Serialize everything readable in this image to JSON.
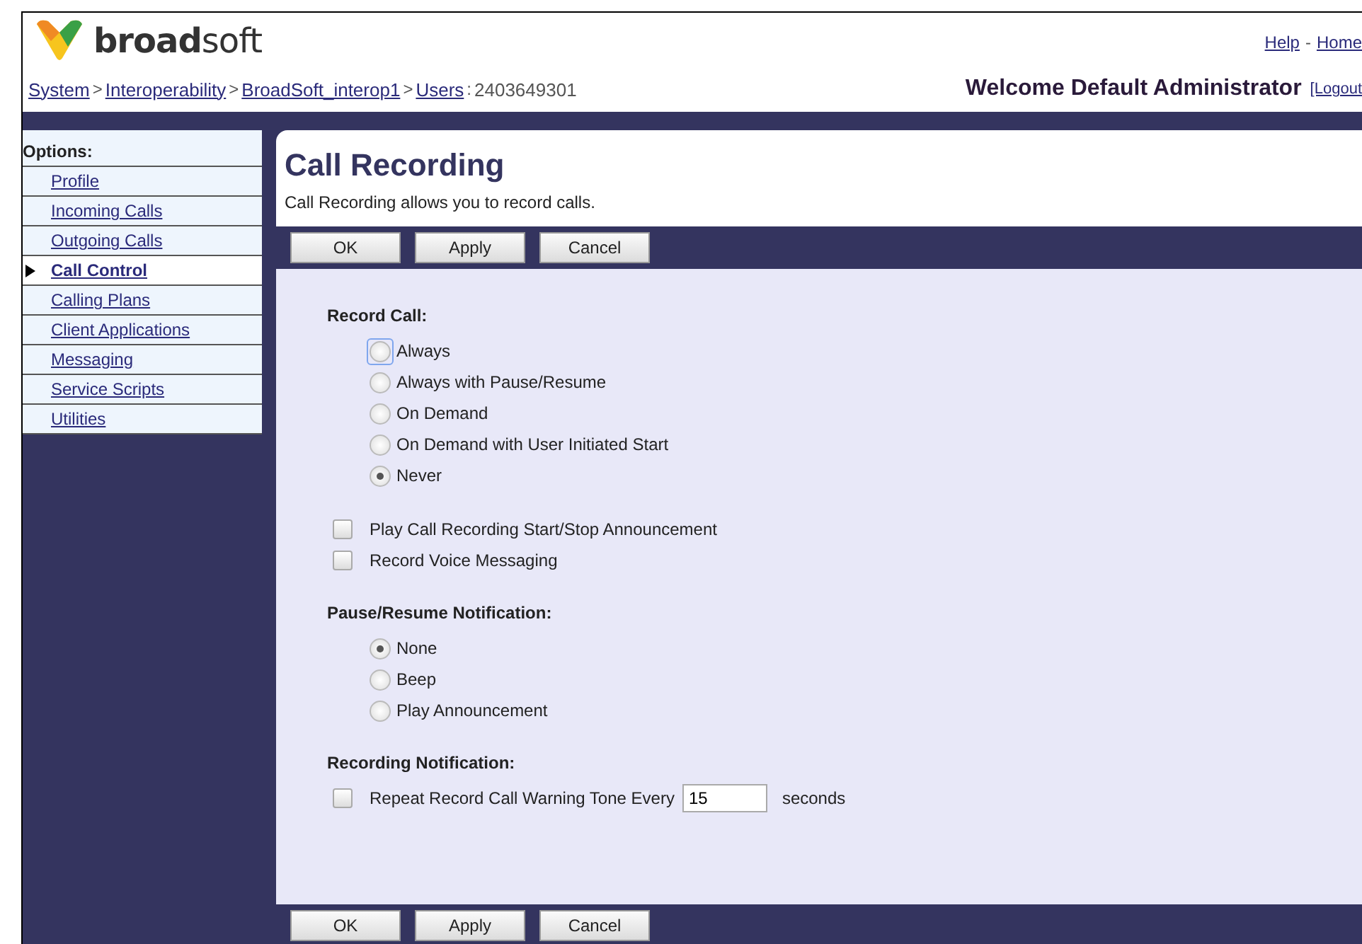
{
  "header": {
    "logo_text": {
      "bold": "broad",
      "light": "soft"
    },
    "top_links": [
      {
        "label": "Help"
      },
      {
        "label": "Home"
      }
    ],
    "top_link_separator": "-",
    "breadcrumb": [
      {
        "label": "System",
        "separator": ">"
      },
      {
        "label": "Interoperability",
        "separator": ">"
      },
      {
        "label": "BroadSoft_interop1",
        "separator": ">"
      },
      {
        "label": "Users",
        "separator": ":"
      }
    ],
    "breadcrumb_tail": "2403649301",
    "welcome": "Welcome Default Administrator",
    "logout": "[Logout"
  },
  "sidebar": {
    "title": "Options:",
    "items": [
      {
        "label": "Profile",
        "selected": false
      },
      {
        "label": "Incoming Calls",
        "selected": false
      },
      {
        "label": "Outgoing Calls",
        "selected": false
      },
      {
        "label": "Call Control",
        "selected": true
      },
      {
        "label": "Calling Plans",
        "selected": false
      },
      {
        "label": "Client Applications",
        "selected": false
      },
      {
        "label": "Messaging",
        "selected": false
      },
      {
        "label": "Service Scripts",
        "selected": false
      },
      {
        "label": "Utilities",
        "selected": false
      }
    ]
  },
  "page": {
    "title": "Call Recording",
    "description": "Call Recording allows you to record calls.",
    "buttons": [
      "OK",
      "Apply",
      "Cancel"
    ],
    "sections": [
      {
        "kind": "radio",
        "title": "Record Call:",
        "options": [
          {
            "label": "Always",
            "selected": false,
            "focused": true
          },
          {
            "label": "Always with Pause/Resume",
            "selected": false,
            "focused": false
          },
          {
            "label": "On Demand",
            "selected": false,
            "focused": false
          },
          {
            "label": "On Demand with User Initiated Start",
            "selected": false,
            "focused": false
          },
          {
            "label": "Never",
            "selected": true,
            "focused": false
          }
        ]
      },
      {
        "kind": "checkbox",
        "options": [
          {
            "label": "Play Call Recording Start/Stop Announcement",
            "checked": false
          },
          {
            "label": "Record Voice Messaging",
            "checked": false
          }
        ]
      },
      {
        "kind": "radio",
        "title": "Pause/Resume Notification:",
        "options": [
          {
            "label": "None",
            "selected": true,
            "focused": false
          },
          {
            "label": "Beep",
            "selected": false,
            "focused": false
          },
          {
            "label": "Play Announcement",
            "selected": false,
            "focused": false
          }
        ]
      },
      {
        "kind": "interval",
        "title": "Recording Notification:",
        "label": "Repeat Record Call Warning Tone Every",
        "checked": false,
        "value": "15",
        "unit": "seconds"
      }
    ],
    "bottom_buttons": [
      "OK",
      "Apply",
      "Cancel"
    ]
  }
}
